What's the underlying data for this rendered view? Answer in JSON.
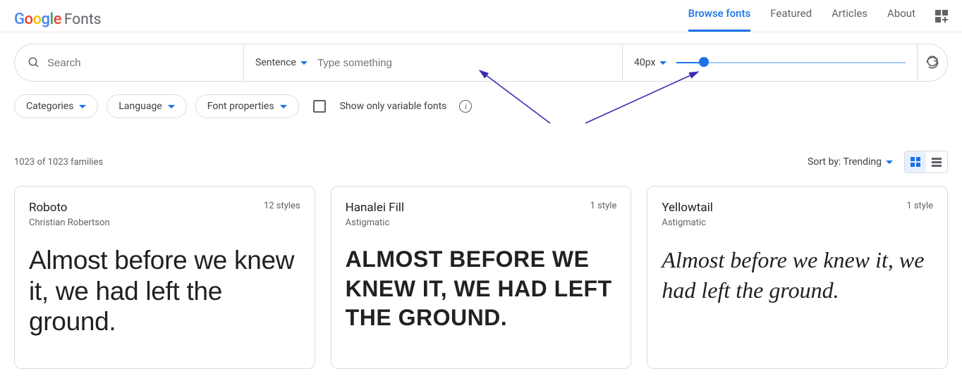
{
  "logo": {
    "google": "Google",
    "fonts": "Fonts"
  },
  "nav": {
    "browse": "Browse fonts",
    "featured": "Featured",
    "articles": "Articles",
    "about": "About"
  },
  "search": {
    "placeholder": "Search"
  },
  "preview": {
    "mode": "Sentence",
    "placeholder": "Type something"
  },
  "size": {
    "label": "40px"
  },
  "filters": {
    "categories": "Categories",
    "language": "Language",
    "properties": "Font properties",
    "variable_label": "Show only variable fonts"
  },
  "results": {
    "count": "1023 of 1023 families",
    "sort_label": "Sort by: Trending"
  },
  "sample_sentence": "Almost before we knew it, we had left the ground.",
  "cards": [
    {
      "name": "Roboto",
      "author": "Christian Robertson",
      "styles": "12 styles"
    },
    {
      "name": "Hanalei Fill",
      "author": "Astigmatic",
      "styles": "1 style"
    },
    {
      "name": "Yellowtail",
      "author": "Astigmatic",
      "styles": "1 style"
    }
  ]
}
